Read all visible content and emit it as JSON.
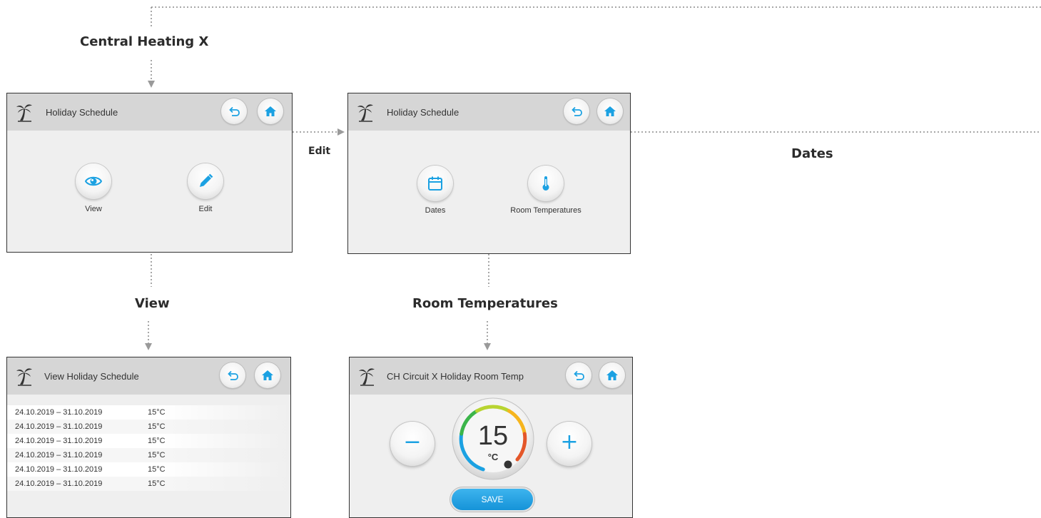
{
  "labels": {
    "central_heating": "Central Heating X",
    "edit": "Edit",
    "dates": "Dates",
    "view": "View",
    "room_temperatures": "Room Temperatures"
  },
  "screens": {
    "holiday": {
      "title": "Holiday Schedule",
      "view_label": "View",
      "edit_label": "Edit"
    },
    "edit": {
      "title": "Holiday Schedule",
      "dates_label": "Dates",
      "room_temps_label": "Room Temperatures"
    },
    "view": {
      "title": "View Holiday Schedule",
      "rows": [
        {
          "dates": "24.10.2019 – 31.10.2019",
          "temp": "15°C"
        },
        {
          "dates": "24.10.2019 – 31.10.2019",
          "temp": "15°C"
        },
        {
          "dates": "24.10.2019 – 31.10.2019",
          "temp": "15°C"
        },
        {
          "dates": "24.10.2019 – 31.10.2019",
          "temp": "15°C"
        },
        {
          "dates": "24.10.2019 – 31.10.2019",
          "temp": "15°C"
        },
        {
          "dates": "24.10.2019 – 31.10.2019",
          "temp": "15°C"
        }
      ]
    },
    "room_temp": {
      "title": "CH Circuit X Holiday Room Temp",
      "value": "15",
      "unit": "°C",
      "minus": "−",
      "plus": "+",
      "save_label": "SAVE"
    }
  },
  "icons": {
    "header": "palm-tree-icon",
    "back": "back-arrow-icon",
    "home": "home-icon",
    "view": "eye-icon",
    "edit": "pencil-icon",
    "dates": "calendar-icon",
    "room_temps": "thermometer-icon"
  },
  "colors": {
    "accent": "#1ba1e2",
    "header_bg": "#d6d6d6",
    "screen_bg": "#efefef"
  }
}
